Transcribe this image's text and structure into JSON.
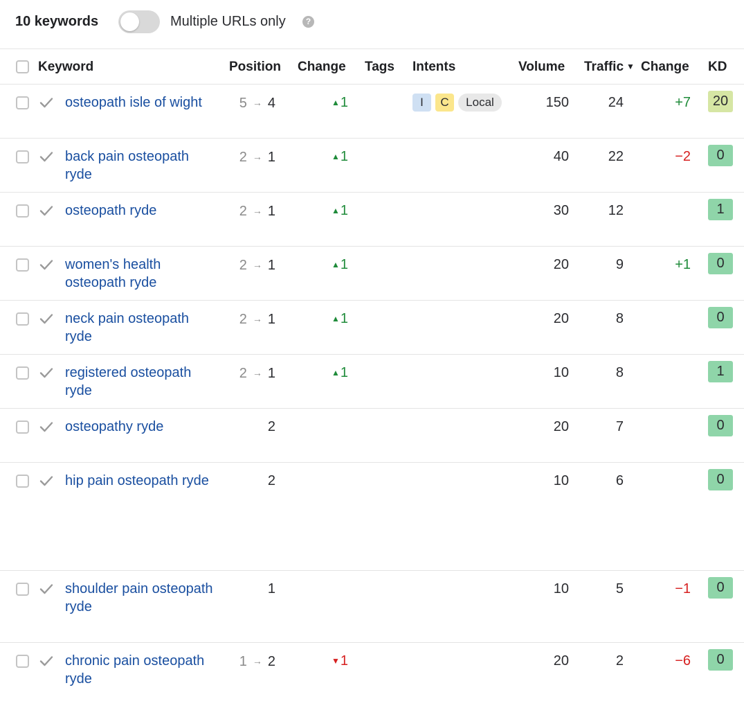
{
  "toolbar": {
    "keyword_count": "10 keywords",
    "toggle_label": "Multiple URLs only",
    "help_icon": "?"
  },
  "columns": {
    "keyword": "Keyword",
    "position": "Position",
    "change": "Change",
    "tags": "Tags",
    "intents": "Intents",
    "volume": "Volume",
    "traffic": "Traffic",
    "traffic_sort_icon": "▼",
    "traffic_change": "Change",
    "kd": "KD"
  },
  "colors": {
    "link": "#1a4fa0",
    "up": "#1f8b3a",
    "down": "#d61f1f",
    "kd_easy": "#8fd5a9",
    "kd_low": "#d6e6a4"
  },
  "rows": [
    {
      "keyword": "osteopath isle of wight",
      "pos_prev": "5",
      "pos_arrow": "→",
      "pos": "4",
      "change_dir": "up",
      "change_icon": "▲",
      "change": "1",
      "intents": [
        "I",
        "C",
        "Local"
      ],
      "volume": "150",
      "traffic": "24",
      "traffic_change": "+7",
      "kd": "20",
      "kd_color": "#d6e6a4"
    },
    {
      "keyword": "back pain osteopath ryde",
      "pos_prev": "2",
      "pos_arrow": "→",
      "pos": "1",
      "change_dir": "up",
      "change_icon": "▲",
      "change": "1",
      "volume": "40",
      "traffic": "22",
      "traffic_change": "−2",
      "kd": "0",
      "kd_color": "#8fd5a9"
    },
    {
      "keyword": "osteopath ryde",
      "pos_prev": "2",
      "pos_arrow": "→",
      "pos": "1",
      "change_dir": "up",
      "change_icon": "▲",
      "change": "1",
      "volume": "30",
      "traffic": "12",
      "traffic_change": "",
      "kd": "1",
      "kd_color": "#8fd5a9"
    },
    {
      "keyword": "women's health osteopath ryde",
      "pos_prev": "2",
      "pos_arrow": "→",
      "pos": "1",
      "change_dir": "up",
      "change_icon": "▲",
      "change": "1",
      "volume": "20",
      "traffic": "9",
      "traffic_change": "+1",
      "kd": "0",
      "kd_color": "#8fd5a9"
    },
    {
      "keyword": "neck pain osteopath ryde",
      "pos_prev": "2",
      "pos_arrow": "→",
      "pos": "1",
      "change_dir": "up",
      "change_icon": "▲",
      "change": "1",
      "volume": "20",
      "traffic": "8",
      "traffic_change": "",
      "kd": "0",
      "kd_color": "#8fd5a9"
    },
    {
      "keyword": "registered osteopath ryde",
      "pos_prev": "2",
      "pos_arrow": "→",
      "pos": "1",
      "change_dir": "up",
      "change_icon": "▲",
      "change": "1",
      "volume": "10",
      "traffic": "8",
      "traffic_change": "",
      "kd": "1",
      "kd_color": "#8fd5a9"
    },
    {
      "keyword": "osteopathy ryde",
      "pos_prev": "",
      "pos_arrow": "",
      "pos": "2",
      "change_dir": "",
      "change_icon": "",
      "change": "",
      "volume": "20",
      "traffic": "7",
      "traffic_change": "",
      "kd": "0",
      "kd_color": "#8fd5a9"
    },
    {
      "keyword": "hip pain osteopath ryde",
      "pos_prev": "",
      "pos_arrow": "",
      "pos": "2",
      "change_dir": "",
      "change_icon": "",
      "change": "",
      "volume": "10",
      "traffic": "6",
      "traffic_change": "",
      "kd": "0",
      "kd_color": "#8fd5a9"
    },
    {
      "keyword": "shoulder pain osteopath ryde",
      "pos_prev": "",
      "pos_arrow": "",
      "pos": "1",
      "change_dir": "",
      "change_icon": "",
      "change": "",
      "volume": "10",
      "traffic": "5",
      "traffic_change": "−1",
      "kd": "0",
      "kd_color": "#8fd5a9"
    },
    {
      "keyword": "chronic pain osteopath ryde",
      "pos_prev": "1",
      "pos_arrow": "→",
      "pos": "2",
      "change_dir": "down",
      "change_icon": "▼",
      "change": "1",
      "volume": "20",
      "traffic": "2",
      "traffic_change": "−6",
      "kd": "0",
      "kd_color": "#8fd5a9"
    }
  ]
}
